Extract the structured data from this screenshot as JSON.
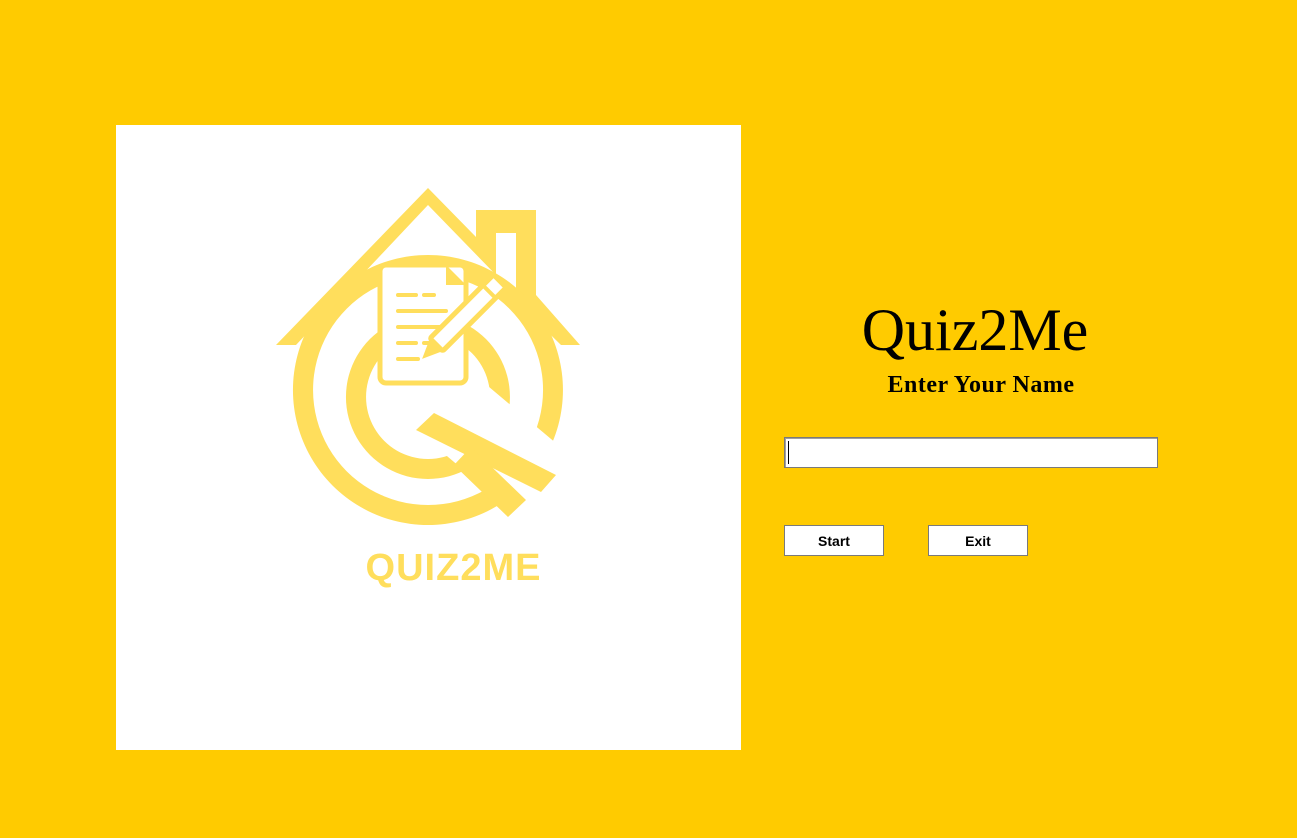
{
  "colors": {
    "background": "#FFCB00",
    "panel": "#FFFFFF",
    "logo": "#FFDE5C",
    "text": "#000000"
  },
  "logo": {
    "icon": "quiz-house-q-icon",
    "wordmark": "QUIZ2ME"
  },
  "title": "Quiz2Me",
  "prompt": "Enter Your Name",
  "name_input": {
    "value": "",
    "placeholder": ""
  },
  "buttons": {
    "start": "Start",
    "exit": "Exit"
  }
}
